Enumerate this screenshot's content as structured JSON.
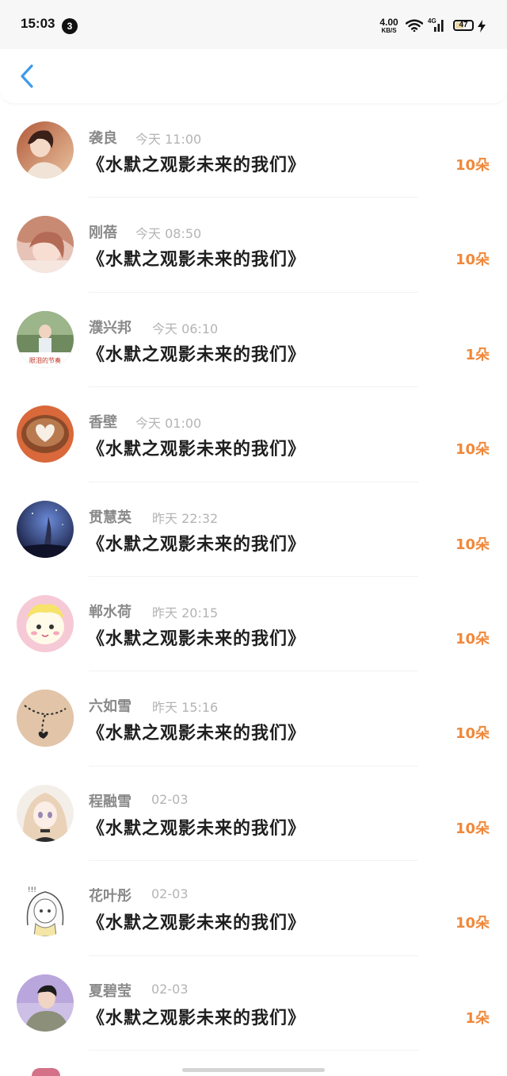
{
  "status_bar": {
    "time": "15:03",
    "notification_count": "3",
    "net_speed_value": "4.00",
    "net_speed_unit": "KB/S",
    "network_label": "4G",
    "battery": "47"
  },
  "header": {
    "back_icon": "chevron-left-icon",
    "accent_color": "#3d9ae8"
  },
  "colors": {
    "amount": "#f0883a",
    "name": "#8a8a8a",
    "time": "#b4b4b4"
  },
  "records": [
    {
      "name": "袭良",
      "time": "今天 11:00",
      "title": "《水默之观影未来的我们》",
      "amount": "10朵"
    },
    {
      "name": "刚蓓",
      "time": "今天 08:50",
      "title": "《水默之观影未来的我们》",
      "amount": "10朵"
    },
    {
      "name": "濮兴邦",
      "time": "今天 06:10",
      "title": "《水默之观影未来的我们》",
      "amount": "1朵"
    },
    {
      "name": "香壁",
      "time": "今天 01:00",
      "title": "《水默之观影未来的我们》",
      "amount": "10朵"
    },
    {
      "name": "贯慧英",
      "time": "昨天 22:32",
      "title": "《水默之观影未来的我们》",
      "amount": "10朵"
    },
    {
      "name": "郸水荷",
      "time": "昨天 20:15",
      "title": "《水默之观影未来的我们》",
      "amount": "10朵"
    },
    {
      "name": "六如雪",
      "time": "昨天 15:16",
      "title": "《水默之观影未来的我们》",
      "amount": "10朵"
    },
    {
      "name": "程融雪",
      "time": "02-03",
      "title": "《水默之观影未来的我们》",
      "amount": "10朵"
    },
    {
      "name": "花叶彤",
      "time": "02-03",
      "title": "《水默之观影未来的我们》",
      "amount": "10朵"
    },
    {
      "name": "夏碧莹",
      "time": "02-03",
      "title": "《水默之观影未来的我们》",
      "amount": "1朵"
    }
  ]
}
